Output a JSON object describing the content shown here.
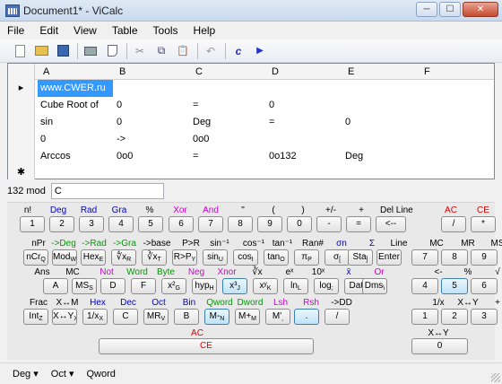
{
  "window": {
    "title": "Document1* - ViCalc",
    "minimize": "─",
    "maximize": "☐",
    "close": "✕"
  },
  "menu": [
    "File",
    "Edit",
    "View",
    "Table",
    "Tools",
    "Help"
  ],
  "toolbar": {
    "icons": [
      "new-document-icon",
      "open-folder-icon",
      "save-icon",
      "print-icon",
      "print-preview-icon",
      "cut-icon",
      "copy-icon",
      "paste-icon",
      "undo-icon",
      "function-icon",
      "run-icon"
    ],
    "cut_glyph": "✂",
    "copy_glyph": "⧉",
    "paste_glyph": "📋",
    "undo_glyph": "↶",
    "function_glyph": "c",
    "run_glyph": "▶"
  },
  "grid": {
    "columns": [
      "A",
      "B",
      "C",
      "D",
      "E",
      "F"
    ],
    "rows": [
      {
        "marker": "▸",
        "cells": [
          "www.CWER.ru",
          "",
          "",
          "",
          "",
          ""
        ]
      },
      {
        "marker": "",
        "cells": [
          "Cube Root of",
          "0",
          "=",
          "0",
          "",
          ""
        ]
      },
      {
        "marker": "",
        "cells": [
          "sin",
          "0",
          "Deg",
          "=",
          "0",
          ""
        ]
      },
      {
        "marker": "",
        "cells": [
          "0",
          "->",
          "0o0",
          "",
          "",
          ""
        ]
      },
      {
        "marker": "",
        "cells": [
          "Arccos",
          "0o0",
          "=",
          "0o132",
          "Deg",
          ""
        ]
      },
      {
        "marker": "✱",
        "cells": [
          "",
          "",
          "",
          "",
          "",
          ""
        ]
      }
    ]
  },
  "command": {
    "label": "132  mod",
    "value": "C"
  },
  "keypad": {
    "labels": [
      [
        "n!",
        "#000"
      ],
      [
        "Deg",
        "#0000cc"
      ],
      [
        "Rad",
        "#0000cc"
      ],
      [
        "Gra",
        "#0000cc"
      ],
      [
        "%",
        "#000"
      ],
      [
        "Xor",
        "#cc00cc"
      ],
      [
        "And",
        "#cc00cc"
      ],
      [
        "\"",
        "#000"
      ],
      [
        "(",
        "#000"
      ],
      [
        ")",
        "#000"
      ],
      [
        "+/-",
        "#000"
      ],
      [
        "+",
        "#000"
      ],
      [
        "Del Line",
        "#000"
      ],
      [
        "AC",
        "#e00000"
      ],
      [
        "CE",
        "#e00000"
      ],
      [
        "nPr",
        "#000"
      ],
      [
        "->Deg",
        "#009900"
      ],
      [
        "->Rad",
        "#009900"
      ],
      [
        "->Gra",
        "#009900"
      ],
      [
        "->base",
        "#000"
      ],
      [
        "P>R",
        "#000"
      ],
      [
        "sin⁻¹",
        "#000"
      ],
      [
        "cos⁻¹",
        "#000"
      ],
      [
        "tan⁻¹",
        "#000"
      ],
      [
        "Ran#",
        "#000"
      ],
      [
        "σn",
        "#0000cc"
      ],
      [
        "Σ",
        "#0000cc"
      ],
      [
        "Line",
        "#000"
      ],
      [
        "MC",
        "#000"
      ],
      [
        "MR",
        "#000"
      ],
      [
        "MS",
        "#000"
      ],
      [
        "Ans",
        "#000"
      ],
      [
        "MC",
        "#000"
      ],
      [
        "Not",
        "#cc00cc"
      ],
      [
        "Word",
        "#009900"
      ],
      [
        "Byte",
        "#009900"
      ],
      [
        "Neg",
        "#cc00cc"
      ],
      [
        "Xnor",
        "#cc00cc"
      ],
      [
        "∛x",
        "#000"
      ],
      [
        "eˣ",
        "#000"
      ],
      [
        "10ˣ",
        "#000"
      ],
      [
        "x̄",
        "#0000cc"
      ],
      [
        "Or",
        "#cc00cc"
      ],
      [
        "<-",
        "#000"
      ],
      [
        "%",
        "#000"
      ],
      [
        "√",
        "#000"
      ],
      [
        "Frac",
        "#000"
      ],
      [
        "X↔M",
        "#000"
      ],
      [
        "Hex",
        "#0000cc"
      ],
      [
        "Dec",
        "#0000cc"
      ],
      [
        "Oct",
        "#0000cc"
      ],
      [
        "Bin",
        "#0000cc"
      ],
      [
        "Qword",
        "#009900"
      ],
      [
        "Dword",
        "#009900"
      ],
      [
        "Lsh",
        "#cc00cc"
      ],
      [
        "Rsh",
        "#cc00cc"
      ],
      [
        "->DD",
        "#000"
      ],
      [
        "1/x",
        "#000"
      ],
      [
        "X↔Y",
        "#000"
      ],
      [
        "+",
        "#000"
      ],
      [
        "AC",
        "#e00000"
      ],
      [
        "X↔Y",
        "#000"
      ]
    ],
    "keys": [
      [
        "1",
        ""
      ],
      [
        "2",
        ""
      ],
      [
        "3",
        ""
      ],
      [
        "4",
        ""
      ],
      [
        "5",
        ""
      ],
      [
        "6",
        ""
      ],
      [
        "7",
        ""
      ],
      [
        "8",
        ""
      ],
      [
        "9",
        ""
      ],
      [
        "0",
        ""
      ],
      [
        "-",
        ""
      ],
      [
        "=",
        ""
      ],
      [
        "<--",
        ""
      ],
      [
        "/",
        ""
      ],
      [
        "*",
        ""
      ],
      [
        "nCr",
        "Q"
      ],
      [
        "Mod",
        "W"
      ],
      [
        "Hex",
        "E"
      ],
      [
        "∜x",
        "R"
      ],
      [
        "∛x",
        "T"
      ],
      [
        "R>P",
        "Y"
      ],
      [
        "sin",
        "U"
      ],
      [
        "cos",
        "I"
      ],
      [
        "tan",
        "O"
      ],
      [
        "π",
        "P"
      ],
      [
        "σ",
        "["
      ],
      [
        "Sta",
        "]"
      ],
      [
        "Enter",
        ""
      ],
      [
        "7",
        ""
      ],
      [
        "8",
        ""
      ],
      [
        "9",
        ""
      ],
      [
        "A",
        ""
      ],
      [
        "MS",
        "S"
      ],
      [
        "D",
        ""
      ],
      [
        "F",
        ""
      ],
      [
        "x²",
        "G"
      ],
      [
        "hyp",
        "H"
      ],
      [
        "x³",
        "J"
      ],
      [
        "xʸ",
        "K"
      ],
      [
        "ln",
        "L"
      ],
      [
        "log",
        ";"
      ],
      [
        "Dat",
        "'"
      ],
      [
        "Dms",
        "\\"
      ],
      [
        "4",
        ""
      ],
      [
        "5",
        ""
      ],
      [
        "6",
        ""
      ],
      [
        "Int",
        "Z"
      ],
      [
        "X↔Y",
        "X"
      ],
      [
        "1/x",
        "X"
      ],
      [
        "C",
        ""
      ],
      [
        "MR",
        "V"
      ],
      [
        "B",
        ""
      ],
      [
        "M-",
        "N"
      ],
      [
        "M+",
        "M"
      ],
      [
        "M'",
        ","
      ],
      [
        ".",
        ""
      ],
      [
        "/",
        ""
      ],
      [
        "1",
        ""
      ],
      [
        "2",
        ""
      ],
      [
        "3",
        ""
      ],
      [
        "CE",
        ""
      ],
      [
        "0",
        ""
      ]
    ]
  },
  "status": [
    "Deg",
    "Oct",
    "Qword"
  ]
}
